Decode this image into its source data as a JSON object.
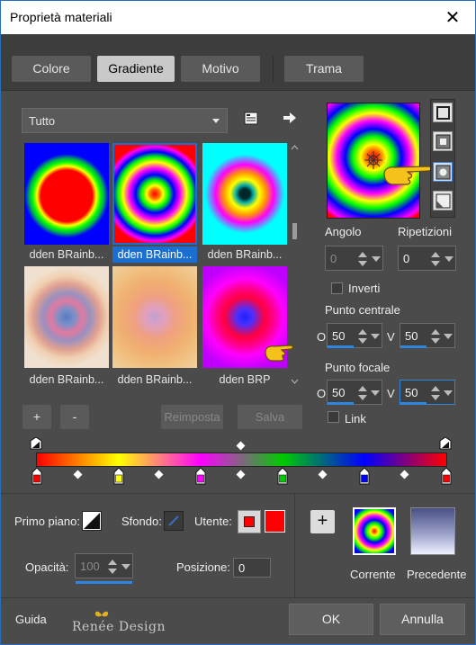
{
  "window": {
    "title": "Proprietà materiali",
    "close_glyph": "✕"
  },
  "tabs": [
    {
      "label": "Colore",
      "active": false
    },
    {
      "label": "Gradiente",
      "active": true
    },
    {
      "label": "Motivo",
      "active": false
    },
    {
      "label": "Trama",
      "active": false
    }
  ],
  "category": {
    "value": "Tutto"
  },
  "presets": [
    {
      "label": "dden BRainb...",
      "selected": false
    },
    {
      "label": "dden BRainb...",
      "selected": true
    },
    {
      "label": "dden BRainb...",
      "selected": false
    },
    {
      "label": "dden BRainb...",
      "selected": false
    },
    {
      "label": "dden BRainb...",
      "selected": false
    },
    {
      "label": "dden BRP",
      "selected": false
    }
  ],
  "preset_buttons": {
    "add": "+",
    "remove": "-",
    "reset": "Reimposta",
    "save": "Salva"
  },
  "angle": {
    "label": "Angolo",
    "value": "0"
  },
  "repeats": {
    "label": "Ripetizioni",
    "value": "0"
  },
  "invert": {
    "label": "Inverti",
    "checked": false
  },
  "center_point": {
    "label": "Punto centrale",
    "h_label": "O",
    "h_value": "50",
    "v_label": "V",
    "v_value": "50"
  },
  "focal_point": {
    "label": "Punto focale",
    "h_label": "O",
    "h_value": "50",
    "v_label": "V",
    "v_value": "50"
  },
  "link": {
    "label": "Link",
    "checked": false
  },
  "gradient_stops": [
    {
      "pos": 0,
      "color": "#ff0000"
    },
    {
      "pos": 0.2,
      "color": "#ffff00"
    },
    {
      "pos": 0.4,
      "color": "#ff00ff"
    },
    {
      "pos": 0.6,
      "color": "#00cc00"
    },
    {
      "pos": 0.8,
      "color": "#0000ff"
    },
    {
      "pos": 1,
      "color": "#ff0000"
    }
  ],
  "bottom": {
    "foreground_label": "Primo piano:",
    "background_label": "Sfondo:",
    "user_label": "Utente:",
    "user_color": "#ff0000",
    "opacity_label": "Opacità:",
    "opacity_value": "100",
    "position_label": "Posizione:",
    "position_value": "0",
    "current_label": "Corrente",
    "previous_label": "Precedente"
  },
  "footer": {
    "help": "Guida",
    "watermark": "Renée Design",
    "ok": "OK",
    "cancel": "Annulla"
  },
  "icons": [
    "folder-icon",
    "arrow-right-icon",
    "linear-style-icon",
    "rectangular-style-icon",
    "radial-style-icon",
    "corner-style-icon",
    "pointing-hand-icon",
    "add-stop-icon"
  ]
}
